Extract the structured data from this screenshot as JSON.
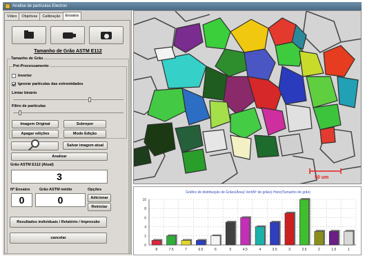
{
  "window": {
    "title": "Análise de partículas Electron"
  },
  "tabs": [
    "Vídeo",
    "Objetivas",
    "Calibração",
    "Ensaios"
  ],
  "toolbar": {
    "open_icon": "folder-icon",
    "video_icon": "video-camera-icon",
    "capture_icon": "camera-icon"
  },
  "panel": {
    "title": "Tamanho de Grão ASTM E112",
    "group_label": "Tamanho de Grão",
    "preprocess_label": "Pré-Processamento",
    "invert_label": "Inverter",
    "invert_checked": false,
    "ignore_label": "Ignorar partículas das extremidades",
    "ignore_checked": true,
    "threshold_label": "Limiar binário",
    "threshold_value": 0.7,
    "filter_label": "Filtro de partículas",
    "filter_value": 0.05,
    "buttons": {
      "original": "Imagem Original",
      "overlay": "Sobrepor",
      "clear_edits": "Apagar edições",
      "edit_mode": "Modo Edição",
      "save_image": "Salvar imagem atual",
      "analyze": "Analizar"
    },
    "current_label": "Grão ASTM E112 (Atual)",
    "current_value": "3",
    "tests_label": "Nº Ensaios",
    "tests_value": "0",
    "mean_label": "Grão ASTM  médio",
    "mean_value": "0",
    "options_label": "Opções",
    "add_label": "Adicionar",
    "reset_label": "Reiniciar",
    "report_label": "Resultados individuais / Relatório / Impressão",
    "cancel_label": "cancelar"
  },
  "image": {
    "scale_label": "50 um",
    "scale_color": "#e61f1f"
  },
  "chart_data": {
    "type": "bar",
    "title": "Gráfico de distribuição de Grãos(Área) Vert(Nº de grãos) Horiz(Tamanho de grão)",
    "categories": [
      "8",
      "7.5",
      "7",
      "6.5",
      "6",
      "5",
      "4.5",
      "4",
      "3.5",
      "3",
      "2.5",
      "2",
      "1.5",
      "1"
    ],
    "values": [
      1,
      2,
      1,
      1,
      2,
      5,
      6,
      4,
      5,
      7,
      10,
      3,
      3,
      3
    ],
    "ylim": [
      0,
      10
    ],
    "yticks": [
      "0",
      "2",
      "4",
      "6",
      "8",
      "10"
    ],
    "grid": true,
    "colors": [
      "#e0263d",
      "#2fae3a",
      "#e3d82a",
      "#2c3ec2",
      "#f4f4f4",
      "#404040",
      "#c42fb8",
      "#1bb0a8",
      "#2f3fbd",
      "#cc1f1f",
      "#3fbf2f",
      "#8a8f1a",
      "#6a1e86",
      "#d8d8d8"
    ]
  }
}
